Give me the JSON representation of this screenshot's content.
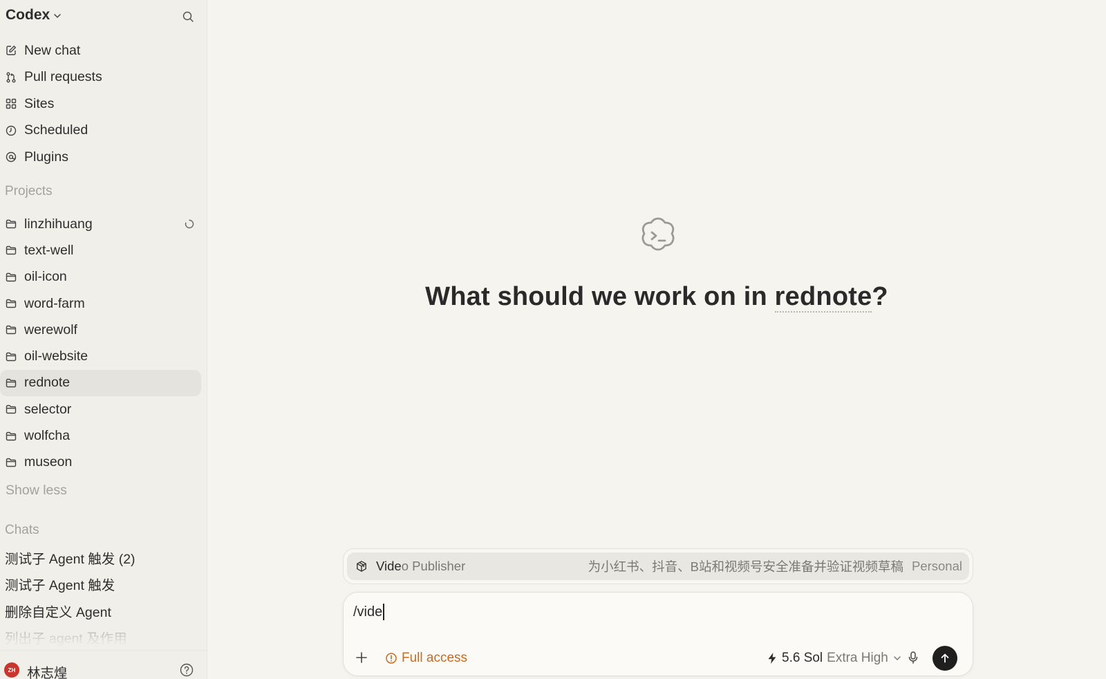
{
  "sidebar": {
    "app_title": "Codex",
    "nav": [
      {
        "label": "New chat",
        "icon": "edit-icon"
      },
      {
        "label": "Pull requests",
        "icon": "pull-request-icon"
      },
      {
        "label": "Sites",
        "icon": "grid-icon"
      },
      {
        "label": "Scheduled",
        "icon": "clock-icon"
      },
      {
        "label": "Plugins",
        "icon": "at-icon"
      }
    ],
    "projects_label": "Projects",
    "projects": [
      {
        "label": "linzhihuang"
      },
      {
        "label": "text-well"
      },
      {
        "label": "oil-icon"
      },
      {
        "label": "word-farm"
      },
      {
        "label": "werewolf"
      },
      {
        "label": "oil-website"
      },
      {
        "label": "rednote"
      },
      {
        "label": "selector"
      },
      {
        "label": "wolfcha"
      },
      {
        "label": "museon"
      }
    ],
    "active_project": "rednote",
    "show_less": "Show less",
    "chats_label": "Chats",
    "chats": [
      {
        "label": "测试子 Agent 触发 (2)"
      },
      {
        "label": "测试子 Agent 触发"
      },
      {
        "label": "删除自定义 Agent"
      },
      {
        "label": "列出子 agent 及作用"
      }
    ],
    "user": {
      "name": "林志煌",
      "initials": "ZH",
      "avatar_color": "#c9362f"
    }
  },
  "main": {
    "hero": {
      "prefix": "What should we work on in ",
      "project": "rednote",
      "suffix": "?"
    },
    "suggestion": {
      "name_match": "Vide",
      "name_rest": "o Publisher",
      "description": "为小红书、抖音、B站和视频号安全准备并验证视频草稿",
      "scope": "Personal",
      "icon": "package-icon"
    },
    "composer": {
      "input_value": "/vide",
      "full_access_label": "Full access",
      "model": "5.6 Sol",
      "effort": "Extra High",
      "accent_color": "#c96a1f"
    }
  }
}
